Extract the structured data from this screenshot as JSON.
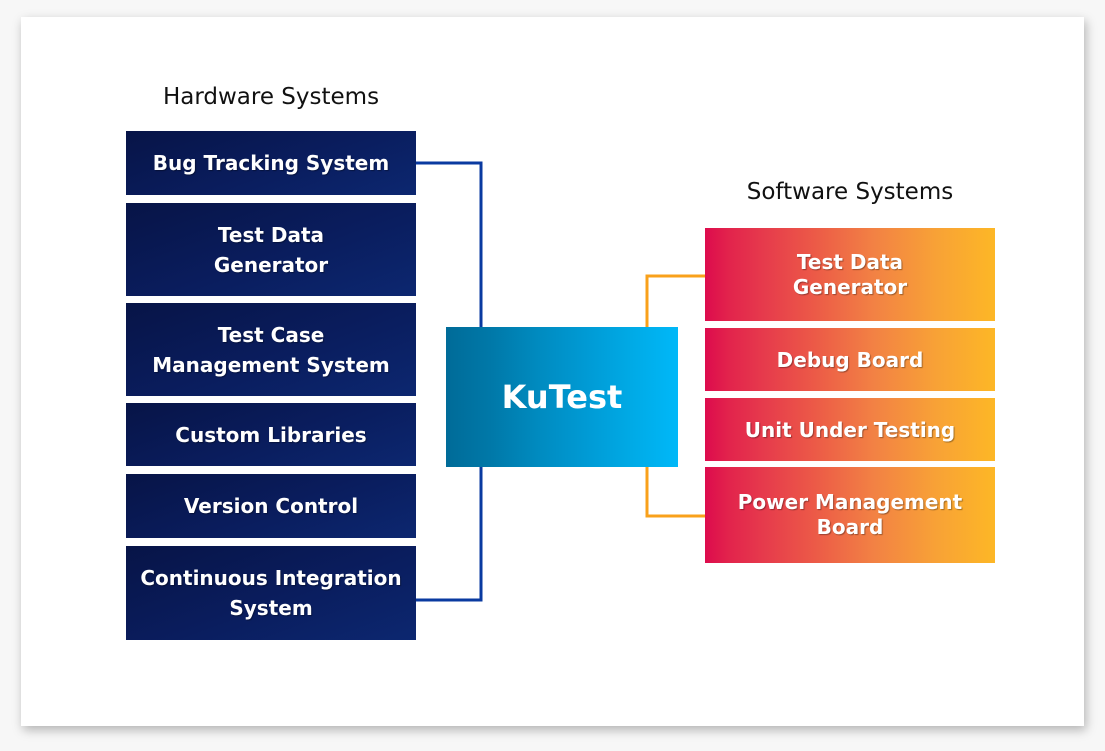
{
  "diagram": {
    "hardware": {
      "title": "Hardware Systems",
      "items": [
        {
          "label": "Bug Tracking System"
        },
        {
          "label": "Test Data Generator"
        },
        {
          "label": "Test Case Management System"
        },
        {
          "label": "Custom Libraries"
        },
        {
          "label": "Version Control"
        },
        {
          "label": "Continuous Integration System"
        }
      ],
      "connector_color": "#0a3aa0",
      "box_color": "#0a1d5e"
    },
    "hub": {
      "label": "KuTest",
      "gradient": [
        "#006b98",
        "#00b8f8"
      ]
    },
    "software": {
      "title": "Software Systems",
      "items": [
        {
          "label": "Test Data Generator"
        },
        {
          "label": "Debug Board"
        },
        {
          "label": "Unit Under Testing"
        },
        {
          "label": "Power Management Board"
        }
      ],
      "connector_color": "#f9a11b",
      "gradient": [
        "#dd0b4d",
        "#fdb726"
      ]
    }
  }
}
